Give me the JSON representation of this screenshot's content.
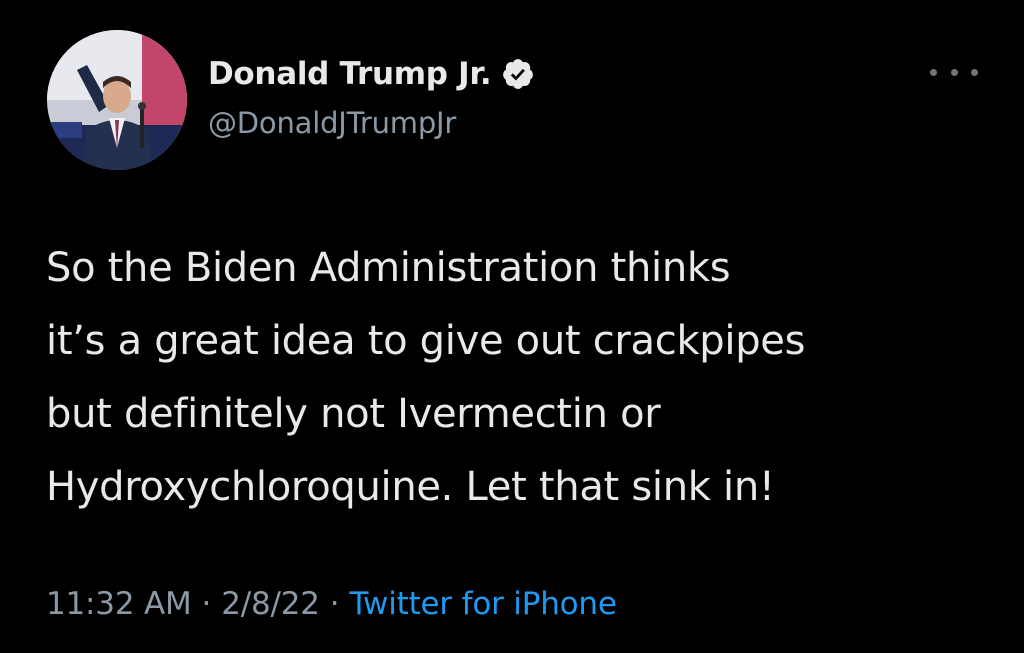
{
  "tweet": {
    "author": {
      "display_name": "Donald Trump Jr.",
      "handle": "@DonaldJTrumpJr",
      "verified": true,
      "verified_icon": "verified-badge-icon"
    },
    "more_icon": "more-options-icon",
    "text": "So the Biden Administration thinks\nit’s a great idea to give out crackpipes\nbut definitely not Ivermectin or\nHydroxychloroquine. Let that sink in!",
    "time": "11:32 AM",
    "date": "2/8/22",
    "separator": "·",
    "source": "Twitter for iPhone"
  },
  "colors": {
    "background": "#000000",
    "text_primary": "#e7e9ea",
    "text_secondary": "#8b98a5",
    "link": "#1d9bf0"
  }
}
